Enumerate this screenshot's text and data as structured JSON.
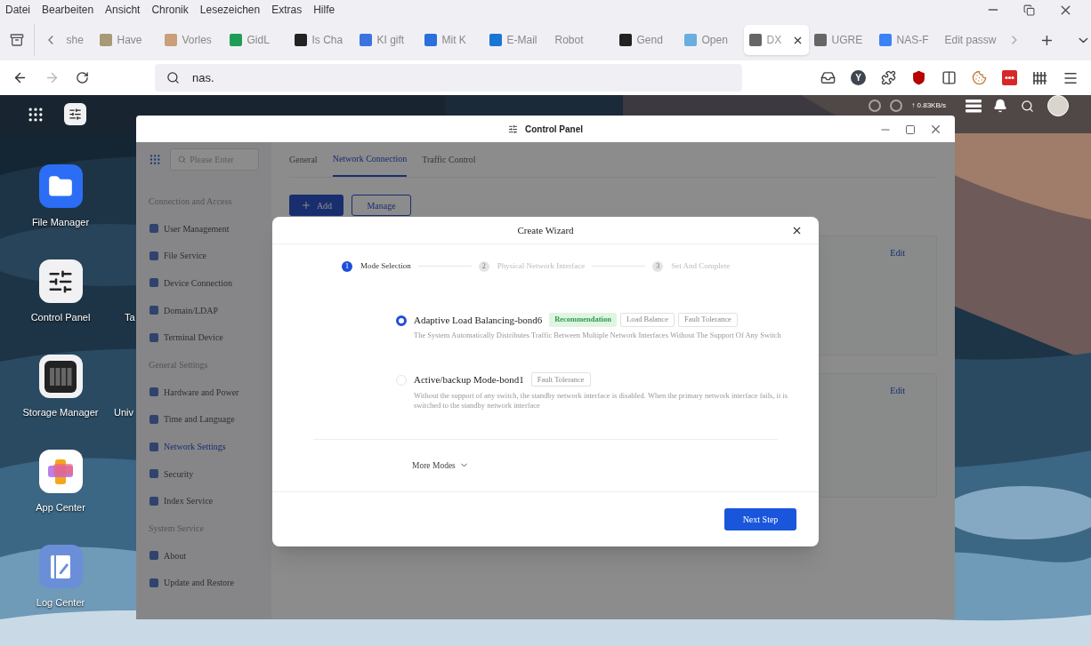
{
  "menu_bar": [
    "Datei",
    "Bearbeiten",
    "Ansicht",
    "Chronik",
    "Lesezeichen",
    "Extras",
    "Hilfe"
  ],
  "tabs": [
    {
      "label": "she",
      "selected": false
    },
    {
      "label": "Have",
      "selected": false,
      "color": "#a89a78"
    },
    {
      "label": "Vorles",
      "selected": false,
      "color": "#c9a07a"
    },
    {
      "label": "GidL",
      "selected": false,
      "color": "#1f9d55"
    },
    {
      "label": "Is Cha",
      "selected": false,
      "color": "#222222"
    },
    {
      "label": "KI gift",
      "selected": false,
      "color": "#3b73e0"
    },
    {
      "label": "Mit K",
      "selected": false,
      "color": "#2a6fdb"
    },
    {
      "label": "E-Mail",
      "selected": false,
      "color": "#1976d2"
    },
    {
      "label": "Robot",
      "selected": false
    },
    {
      "label": "Gend",
      "selected": false,
      "color": "#222222"
    },
    {
      "label": "Open",
      "selected": false,
      "color": "#6aaee0"
    },
    {
      "label": "DX",
      "selected": true,
      "color": "#666666"
    },
    {
      "label": "UGRE",
      "selected": false,
      "color": "#666666"
    },
    {
      "label": "NAS-F",
      "selected": false,
      "color": "#3b82f6"
    },
    {
      "label": "Edit passw",
      "selected": false
    }
  ],
  "address_bar": {
    "value": "nas.",
    "extension_badge": "Y"
  },
  "desktop": {
    "transfer_rate": "↑ 0.83KB/s",
    "icons": [
      {
        "label": "File Manager",
        "kind": "folder"
      },
      {
        "label": "Control Panel",
        "kind": "sliders"
      },
      {
        "label": "Storage Manager",
        "kind": "storage"
      },
      {
        "label": "App Center",
        "kind": "apps"
      },
      {
        "label": "Log Center",
        "kind": "log"
      }
    ],
    "partial_labels": [
      "Ta",
      "Univ"
    ]
  },
  "control_panel": {
    "title": "Control Panel",
    "search": {
      "placeholder": "Please Enter"
    },
    "sidebar": [
      {
        "kind": "header",
        "label": "Connection and Access"
      },
      {
        "kind": "item",
        "label": "User Management",
        "selected": false
      },
      {
        "kind": "item",
        "label": "File Service",
        "selected": false
      },
      {
        "kind": "item",
        "label": "Device Connection",
        "selected": false
      },
      {
        "kind": "item",
        "label": "Domain/LDAP",
        "selected": false
      },
      {
        "kind": "item",
        "label": "Terminal Device",
        "selected": false
      },
      {
        "kind": "header",
        "label": "General Settings"
      },
      {
        "kind": "item",
        "label": "Hardware and Power",
        "selected": false
      },
      {
        "kind": "item",
        "label": "Time and Language",
        "selected": false
      },
      {
        "kind": "item",
        "label": "Network Settings",
        "selected": true
      },
      {
        "kind": "item",
        "label": "Security",
        "selected": false
      },
      {
        "kind": "item",
        "label": "Index Service",
        "selected": false
      },
      {
        "kind": "header",
        "label": "System Service"
      },
      {
        "kind": "item",
        "label": "About",
        "selected": false
      },
      {
        "kind": "item",
        "label": "Update and Restore",
        "selected": false
      }
    ],
    "tabs": [
      {
        "label": "General",
        "selected": false
      },
      {
        "label": "Network Connection",
        "selected": true
      },
      {
        "label": "Traffic Control",
        "selected": false
      }
    ],
    "add_button": "Add",
    "manage_button": "Manage",
    "cards": [
      {
        "action": "Edit"
      },
      {
        "action": "Edit"
      }
    ]
  },
  "wizard": {
    "title": "Create Wizard",
    "steps": [
      {
        "number": "1",
        "label": "Mode Selection",
        "selected": true
      },
      {
        "number": "2",
        "label": "Physical Network Interface",
        "selected": false
      },
      {
        "number": "3",
        "label": "Set And Complete",
        "selected": false
      }
    ],
    "modes": [
      {
        "title": "Adaptive Load Balancing-bond6",
        "selected": true,
        "tags": [
          {
            "label": "Recommendation",
            "kind": "recommended"
          },
          {
            "label": "Load Balance",
            "kind": "plain"
          },
          {
            "label": "Fault Tolerance",
            "kind": "plain"
          }
        ],
        "description": "The System Automatically Distributes Traffic Between Multiple Network Interfaces Without The Support Of Any Switch"
      },
      {
        "title": "Active/backup Mode-bond1",
        "selected": false,
        "tags": [
          {
            "label": "Fault Tolerance",
            "kind": "plain"
          }
        ],
        "description": "Without the support of any switch, the standby network interface is disabled. When the primary network interface fails, it is switched to the standby network interface"
      }
    ],
    "more": "More Modes",
    "next": "Next Step"
  }
}
